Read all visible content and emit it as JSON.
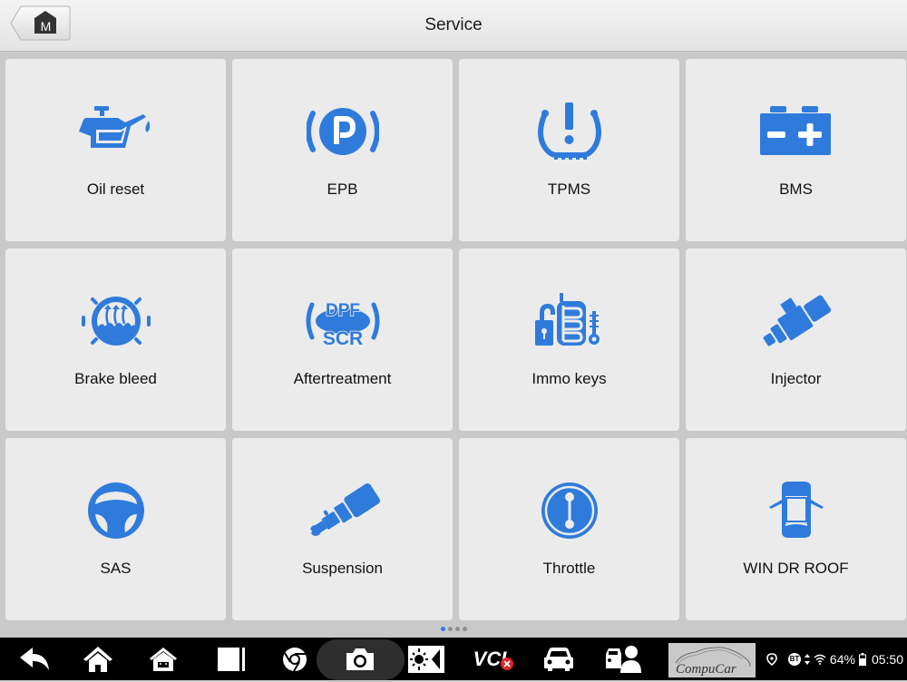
{
  "header": {
    "title": "Service",
    "home_button_letter": "M",
    "home_icon": "home-m-icon"
  },
  "tiles": [
    {
      "label": "Oil reset",
      "icon": "oil-can-icon"
    },
    {
      "label": "EPB",
      "icon": "parking-brake-icon"
    },
    {
      "label": "TPMS",
      "icon": "tire-pressure-icon"
    },
    {
      "label": "BMS",
      "icon": "battery-icon"
    },
    {
      "label": "Brake bleed",
      "icon": "brake-fluid-icon"
    },
    {
      "label": "Aftertreatment",
      "icon": "dpf-scr-icon"
    },
    {
      "label": "Immo keys",
      "icon": "immobilizer-key-icon"
    },
    {
      "label": "Injector",
      "icon": "injector-icon"
    },
    {
      "label": "SAS",
      "icon": "steering-wheel-icon"
    },
    {
      "label": "Suspension",
      "icon": "suspension-icon"
    },
    {
      "label": "Throttle",
      "icon": "throttle-icon"
    },
    {
      "label": "WIN DR ROOF",
      "icon": "car-doors-icon"
    }
  ],
  "pagination": {
    "pages": 4,
    "current": 1
  },
  "navbar": {
    "items": [
      "back",
      "home",
      "android-home",
      "recent-apps",
      "chrome",
      "screenshot-camera",
      "brightness-volume",
      "vci",
      "vehicle",
      "remote-expert"
    ],
    "vci_label": "VCI",
    "logo_text": "CompuCar"
  },
  "status": {
    "bluetooth_label": "BT",
    "battery_percent": "64%",
    "time": "05:50"
  },
  "colors": {
    "accent": "#2f7bdc",
    "tile_bg": "#ebebeb",
    "grid_bg": "#c9c9c9",
    "navbar_bg": "#000000",
    "vci_error": "#e0242b"
  }
}
